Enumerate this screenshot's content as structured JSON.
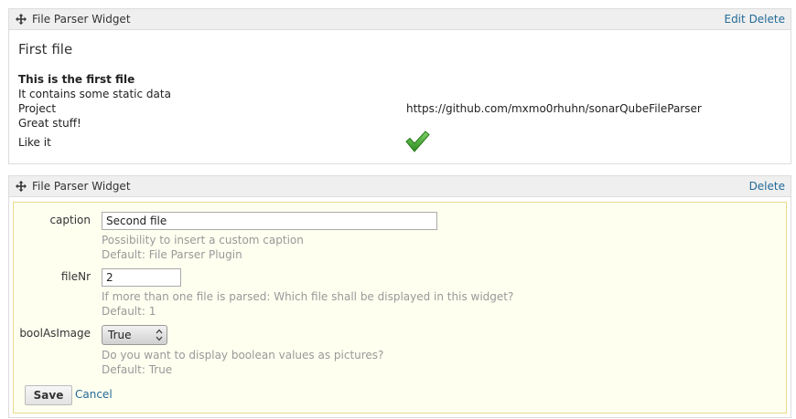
{
  "widget1": {
    "title": "File Parser Widget",
    "edit_label": "Edit",
    "delete_label": "Delete",
    "caption": "First file",
    "description_title": "This is the first file",
    "description_line": "It contains some static data",
    "rows": [
      {
        "label": "Project",
        "value": "https://github.com/mxmo0rhuhn/sonarQubeFileParser"
      },
      {
        "label": "Great stuff!",
        "value": ""
      },
      {
        "label": "Like it",
        "value_icon": "green-checkmark-icon"
      }
    ]
  },
  "widget2": {
    "title": "File Parser Widget",
    "delete_label": "Delete",
    "form": {
      "caption": {
        "label": "caption",
        "value": "Second file",
        "help": "Possibility to insert a custom caption",
        "default": "Default: File Parser Plugin"
      },
      "fileNr": {
        "label": "fileNr",
        "value": "2",
        "help": "If more than one file is parsed: Which file shall be displayed in this widget?",
        "default": "Default: 1"
      },
      "boolAsImage": {
        "label": "boolAsImage",
        "selected": "True",
        "help": "Do you want to display boolean values as pictures?",
        "default": "Default: True"
      },
      "save_label": "Save",
      "cancel_label": "Cancel"
    }
  },
  "colors": {
    "link": "#236a97",
    "header_bg": "#efefef",
    "form_bg": "#fffff0",
    "form_border": "#e7dc8c",
    "check_green": "#3a9a2a"
  },
  "icons": [
    "move-icon",
    "green-checkmark-icon",
    "select-arrows-icon"
  ]
}
